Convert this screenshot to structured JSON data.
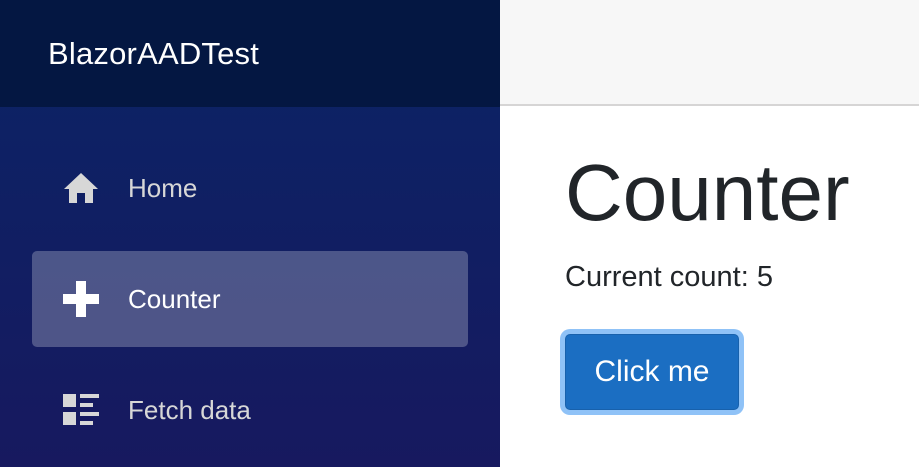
{
  "app": {
    "brand": "BlazorAADTest"
  },
  "sidebar": {
    "items": [
      {
        "label": "Home",
        "icon": "home-icon",
        "active": false
      },
      {
        "label": "Counter",
        "icon": "plus-icon",
        "active": true
      },
      {
        "label": "Fetch data",
        "icon": "list-rich-icon",
        "active": false
      }
    ]
  },
  "main": {
    "title": "Counter",
    "count_prefix": "Current count: ",
    "count": 5,
    "button_label": "Click me"
  },
  "colors": {
    "sidebar_top": "#041742",
    "sidebar_gradient_start": "#0a2466",
    "sidebar_gradient_end": "#17195f",
    "button_primary": "#1b6ec2",
    "button_focus_ring": "#8fc2f7",
    "text": "#212529"
  }
}
